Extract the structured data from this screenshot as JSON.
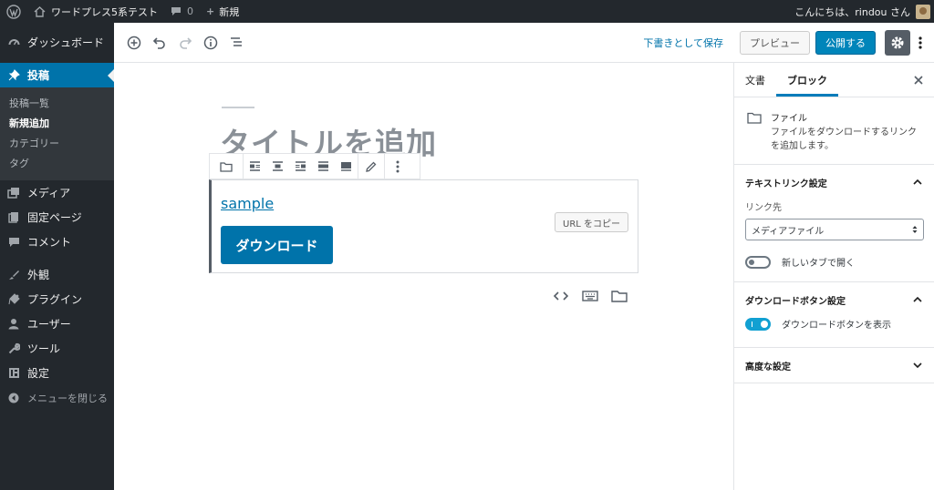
{
  "admin_bar": {
    "site_name": "ワードプレス5系テスト",
    "comments_count": "0",
    "new_label": "新規",
    "greeting": "こんにちは、rindou さん"
  },
  "sidebar": {
    "items": [
      {
        "label": "ダッシュボード",
        "icon": "dashboard-icon"
      },
      {
        "label": "投稿",
        "icon": "pushpin-icon"
      },
      {
        "label": "メディア",
        "icon": "media-icon"
      },
      {
        "label": "固定ページ",
        "icon": "page-icon"
      },
      {
        "label": "コメント",
        "icon": "comment-icon"
      },
      {
        "label": "外観",
        "icon": "appearance-icon"
      },
      {
        "label": "プラグイン",
        "icon": "plugin-icon"
      },
      {
        "label": "ユーザー",
        "icon": "user-icon"
      },
      {
        "label": "ツール",
        "icon": "wrench-icon"
      },
      {
        "label": "設定",
        "icon": "settings-icon"
      },
      {
        "label": "メニューを閉じる",
        "icon": "collapse-icon"
      }
    ],
    "submenu": [
      "投稿一覧",
      "新規追加",
      "カテゴリー",
      "タグ"
    ]
  },
  "header": {
    "save_draft": "下書きとして保存",
    "preview": "プレビュー",
    "publish": "公開する"
  },
  "editor": {
    "title_placeholder": "タイトルを追加",
    "file_link": "sample",
    "copy_url": "URL をコピー",
    "download_button": "ダウンロード"
  },
  "panel": {
    "tab_document": "文書",
    "tab_block": "ブロック",
    "block_name": "ファイル",
    "block_description": "ファイルをダウンロードするリンクを追加します。",
    "text_link_title": "テキストリンク設定",
    "link_to_label": "リンク先",
    "link_to_value": "メディアファイル",
    "open_new_tab": "新しいタブで開く",
    "open_new_tab_checked": false,
    "download_settings_title": "ダウンロードボタン設定",
    "show_download_button": "ダウンロードボタンを表示",
    "show_download_button_checked": true,
    "advanced_title": "高度な設定"
  },
  "colors": {
    "admin_dark": "#23282d",
    "accent": "#0073aa",
    "publish": "#0085ba"
  }
}
